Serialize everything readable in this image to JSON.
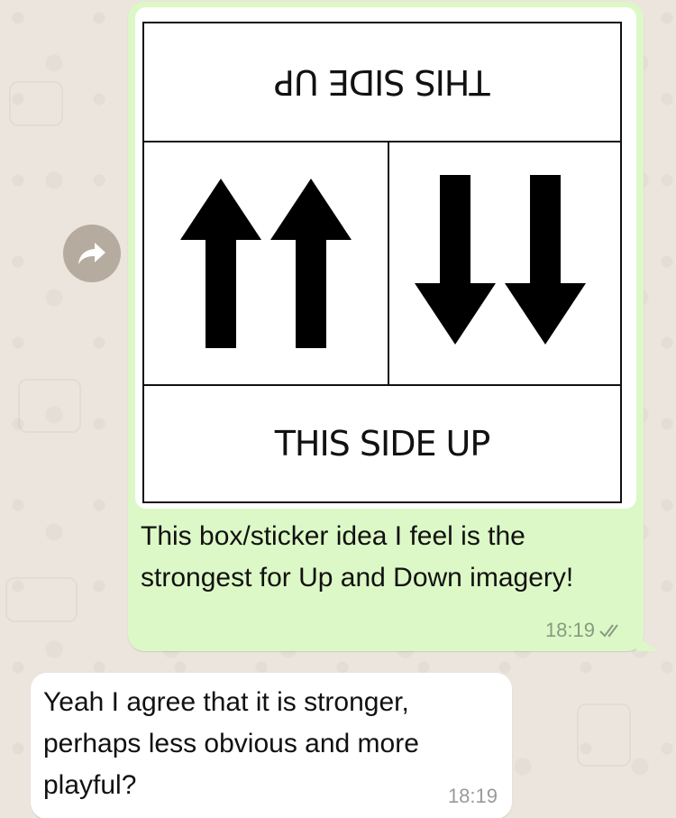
{
  "outgoing_message": {
    "image": {
      "top_label": "THIS SIDE UP",
      "bottom_label": "THIS SIDE UP"
    },
    "text": "This box/sticker idea I feel is the strongest for Up and Down imagery!",
    "time": "18:19",
    "status_icon": "double-check-read-icon"
  },
  "forward_icon": "forward-arrow-icon",
  "incoming_message": {
    "text": "Yeah I agree that it is stronger, perhaps less obvious and more playful?",
    "time": "18:19"
  },
  "colors": {
    "outgoing_bubble": "#dcf8c6",
    "incoming_bubble": "#ffffff",
    "chat_background": "#ece5dd",
    "forward_button": "#b5ab9f"
  }
}
